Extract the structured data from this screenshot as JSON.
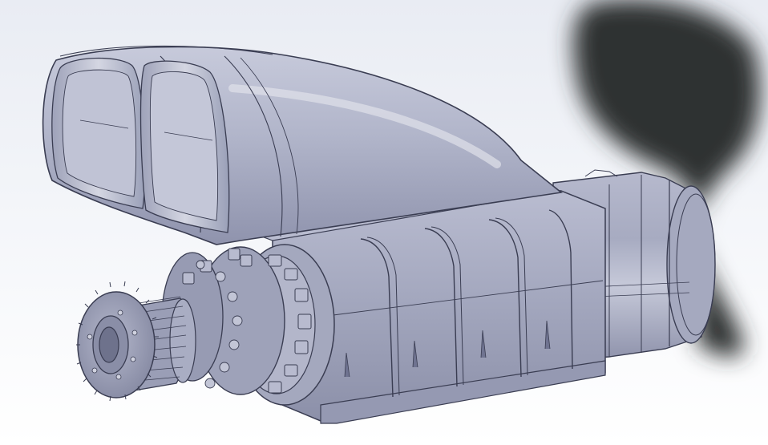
{
  "scene": {
    "model": "supercharger-assembly",
    "view": "isometric-shaded",
    "colors": {
      "background_top": "#e9ecf3",
      "background_bottom": "#ffffff",
      "part_base": "#a9adc3",
      "part_light": "#c9ccdc",
      "part_dark": "#6f7390",
      "edge": "#3a3d52",
      "shadow": "#2f3033"
    }
  }
}
